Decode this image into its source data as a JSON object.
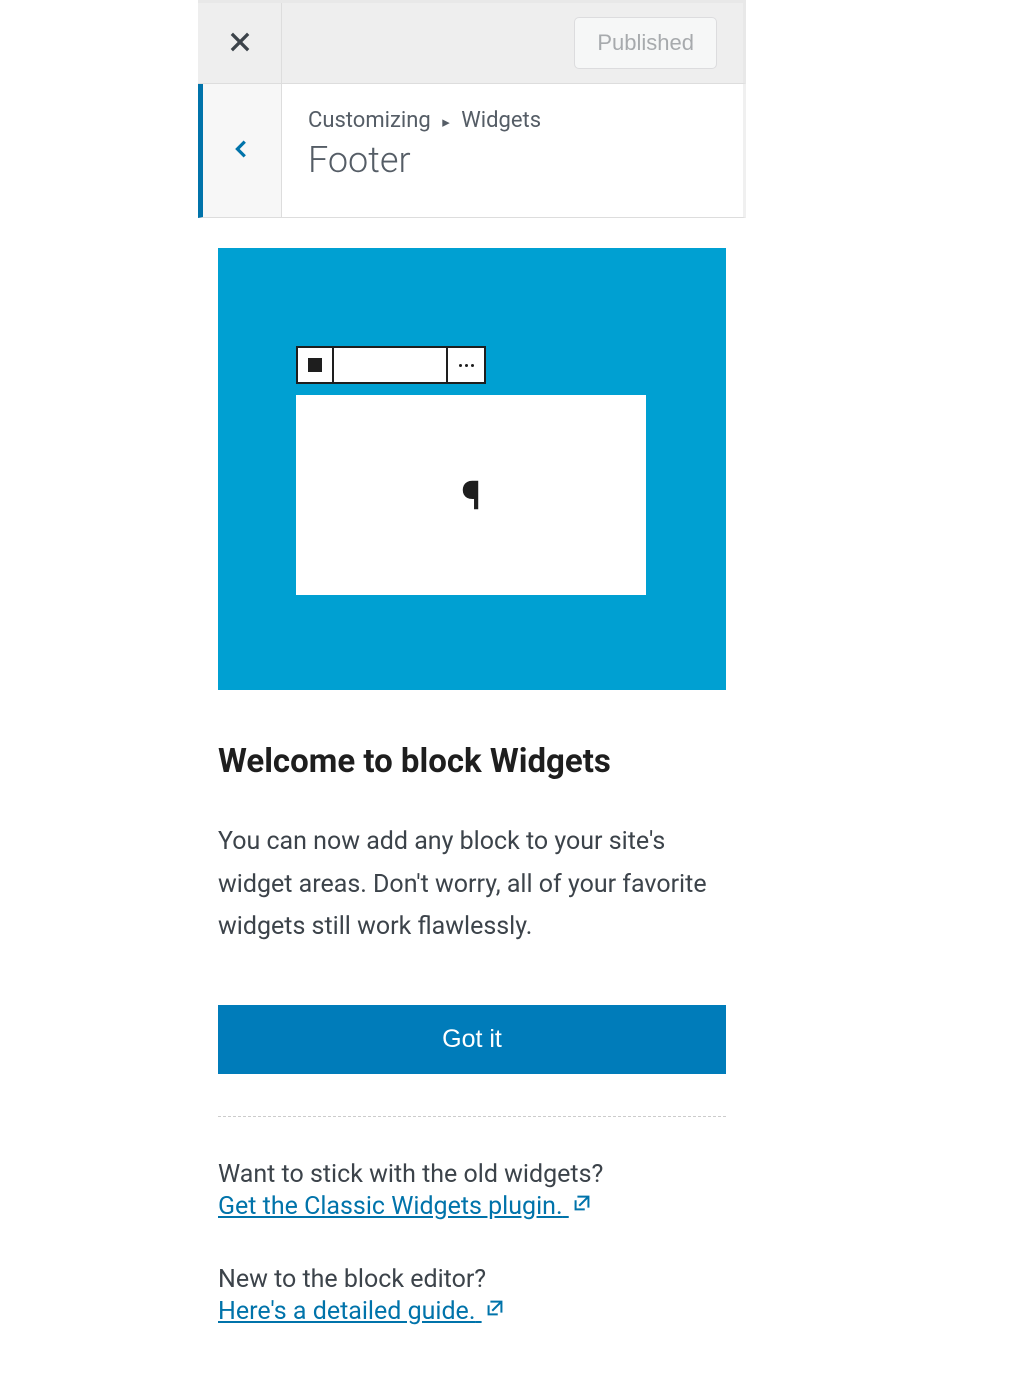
{
  "topbar": {
    "published_label": "Published"
  },
  "nav": {
    "breadcrumb_root": "Customizing",
    "breadcrumb_current": "Widgets",
    "section_title": "Footer"
  },
  "welcome": {
    "title": "Welcome to block Widgets",
    "description": "You can now add any block to your site's widget areas. Don't worry, all of your favorite widgets still work flawlessly.",
    "got_it_label": "Got it"
  },
  "classic": {
    "prompt": "Want to stick with the old widgets?",
    "link_text": "Get the Classic Widgets plugin."
  },
  "guide": {
    "prompt": "New to the block editor?",
    "link_text": "Here's a detailed guide."
  },
  "colors": {
    "accent": "#007cba",
    "illustration_bg": "#00a0d2",
    "link": "#0073aa"
  }
}
